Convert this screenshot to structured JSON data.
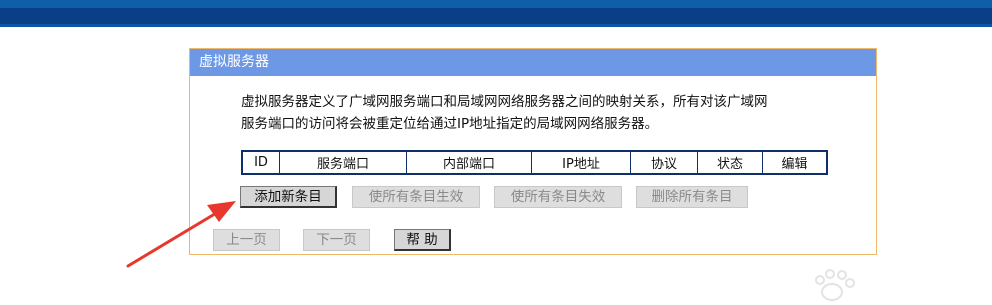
{
  "panel": {
    "title": "虚拟服务器",
    "description_line1": "虚拟服务器定义了广域网服务端口和局域网网络服务器之间的映射关系，所有对该广域网",
    "description_line2": "服务端口的访问将会被重定位给通过IP地址指定的局域网网络服务器。"
  },
  "table": {
    "headers": [
      "ID",
      "服务端口",
      "内部端口",
      "IP地址",
      "协议",
      "状态",
      "编辑"
    ]
  },
  "buttons": {
    "add_new": "添加新条目",
    "enable_all": "使所有条目生效",
    "disable_all": "使所有条目失效",
    "delete_all": "删除所有条目",
    "prev_page": "上一页",
    "next_page": "下一页",
    "help": "帮 助"
  },
  "colors": {
    "banner": "#0a3f88",
    "title_bar": "#6d98e6",
    "panel_border": "#f0b96a",
    "annotation_arrow": "#e8372c"
  }
}
